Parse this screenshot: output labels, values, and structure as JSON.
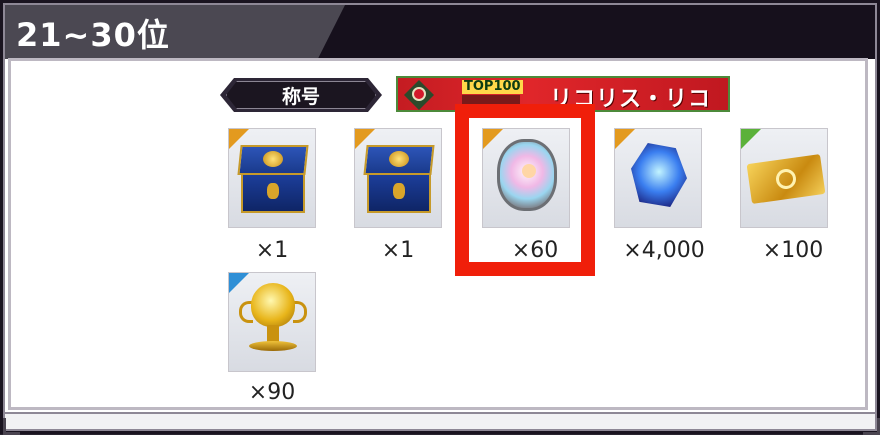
{
  "section": {
    "title": "21~30位"
  },
  "title_label": "称号",
  "title_banner": {
    "top_text": "TOP100",
    "logo_text": "リコリス・リコイル"
  },
  "rewards": [
    {
      "name": "blue-gold-box",
      "quantity": "×1",
      "rarity_color": "#e39a1f"
    },
    {
      "name": "blue-gold-box",
      "quantity": "×1",
      "rarity_color": "#e39a1f"
    },
    {
      "name": "character-medal",
      "quantity": "×60",
      "rarity_color": "#e39a1f"
    },
    {
      "name": "blue-crystal",
      "quantity": "×4,000",
      "rarity_color": "#e39a1f"
    },
    {
      "name": "gold-ticket",
      "quantity": "×100",
      "rarity_color": "#5bb13a"
    },
    {
      "name": "golden-chalice",
      "quantity": "×90",
      "rarity_color": "#2f8fd6"
    }
  ],
  "highlight_color": "#f01f0a"
}
